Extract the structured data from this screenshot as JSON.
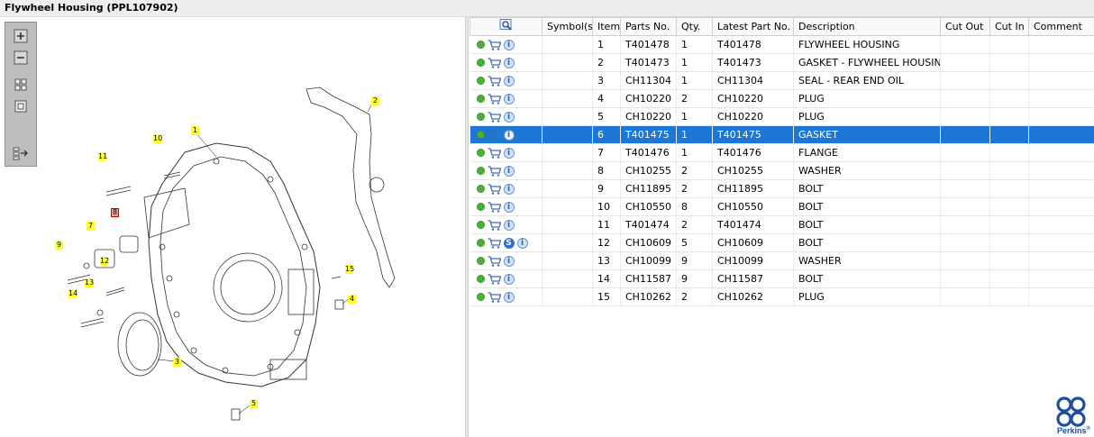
{
  "window": {
    "title": "Flywheel Housing (PPL107902)"
  },
  "diagram": {
    "tools": [
      "zoom-in",
      "zoom-out",
      "fit-all",
      "actual-size",
      "export-list"
    ],
    "callouts": [
      "1",
      "2",
      "3",
      "4",
      "5",
      "7",
      "8",
      "9",
      "10",
      "11",
      "12",
      "13",
      "14",
      "15"
    ],
    "highlighted_callout": "8"
  },
  "grid": {
    "columns": [
      "",
      "Symbol(s)",
      "Item",
      "Parts No.",
      "Qty.",
      "Latest Part No.",
      "Description",
      "Cut Out",
      "Cut In",
      "Comment"
    ],
    "rows": [
      {
        "item": "1",
        "part": "T401478",
        "qty": "1",
        "latest": "T401478",
        "desc": "FLYWHEEL HOUSING",
        "symbol": ""
      },
      {
        "item": "2",
        "part": "T401473",
        "qty": "1",
        "latest": "T401473",
        "desc": "GASKET - FLYWHEEL HOUSING",
        "symbol": ""
      },
      {
        "item": "3",
        "part": "CH11304",
        "qty": "1",
        "latest": "CH11304",
        "desc": "SEAL - REAR END OIL",
        "symbol": ""
      },
      {
        "item": "4",
        "part": "CH10220",
        "qty": "2",
        "latest": "CH10220",
        "desc": "PLUG",
        "symbol": ""
      },
      {
        "item": "5",
        "part": "CH10220",
        "qty": "1",
        "latest": "CH10220",
        "desc": "PLUG",
        "symbol": ""
      },
      {
        "item": "6",
        "part": "T401475",
        "qty": "1",
        "latest": "T401475",
        "desc": "GASKET",
        "symbol": "",
        "selected": true
      },
      {
        "item": "7",
        "part": "T401476",
        "qty": "1",
        "latest": "T401476",
        "desc": "FLANGE",
        "symbol": ""
      },
      {
        "item": "8",
        "part": "CH10255",
        "qty": "2",
        "latest": "CH10255",
        "desc": "WASHER",
        "symbol": ""
      },
      {
        "item": "9",
        "part": "CH11895",
        "qty": "2",
        "latest": "CH11895",
        "desc": "BOLT",
        "symbol": ""
      },
      {
        "item": "10",
        "part": "CH10550",
        "qty": "8",
        "latest": "CH10550",
        "desc": "BOLT",
        "symbol": ""
      },
      {
        "item": "11",
        "part": "T401474",
        "qty": "2",
        "latest": "T401474",
        "desc": "BOLT",
        "symbol": ""
      },
      {
        "item": "12",
        "part": "CH10609",
        "qty": "5",
        "latest": "CH10609",
        "desc": "BOLT",
        "symbol": "S"
      },
      {
        "item": "13",
        "part": "CH10099",
        "qty": "9",
        "latest": "CH10099",
        "desc": "WASHER",
        "symbol": ""
      },
      {
        "item": "14",
        "part": "CH11587",
        "qty": "9",
        "latest": "CH11587",
        "desc": "BOLT",
        "symbol": ""
      },
      {
        "item": "15",
        "part": "CH10262",
        "qty": "2",
        "latest": "CH10262",
        "desc": "PLUG",
        "symbol": ""
      }
    ]
  },
  "brand": {
    "name": "Perkins",
    "trademark": "®",
    "color": "#1d4ea0"
  },
  "colors": {
    "selection": "#1c78d4",
    "callout": "#ffff33",
    "highlight_callout": "#ff9a9a"
  }
}
